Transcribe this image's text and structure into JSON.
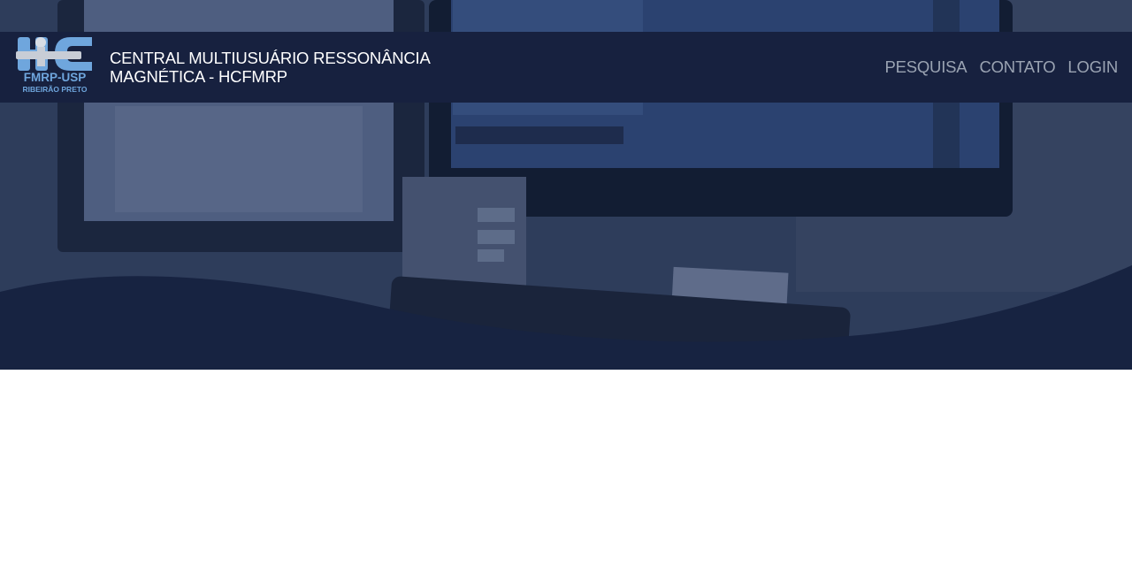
{
  "brand": {
    "logo_main": "HC",
    "logo_line1": "FMRP-USP",
    "logo_line2": "RIBEIRÃO PRETO",
    "title_line1": "CENTRAL MULTIUSUÁRIO RESSONÂNCIA",
    "title_line2": "MAGNÉTICA - HCFMRP"
  },
  "nav": {
    "items": [
      {
        "label": "PESQUISA"
      },
      {
        "label": "CONTATO"
      },
      {
        "label": "LOGIN"
      }
    ]
  },
  "colors": {
    "navbar": "#17213f",
    "nav_link": "#9aa3b2",
    "logo_blue": "#6fa6dd"
  }
}
